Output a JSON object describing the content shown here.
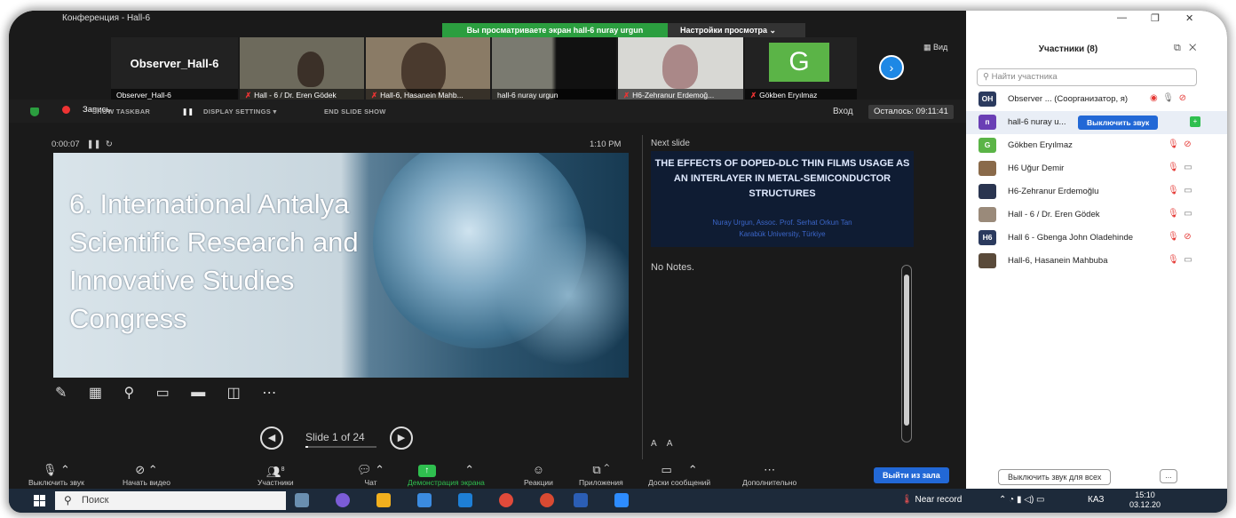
{
  "window": {
    "title": "Конференция - Hall-6"
  },
  "share_banner": {
    "text": "Вы просматриваете экран hall-6 nuray urgun",
    "view_options": "Настройки просмотра",
    "chevron": "⌄"
  },
  "video_strip": {
    "tiles": [
      {
        "name": "Observer_Hall-6",
        "display": "Observer_Hall-6",
        "muted": false
      },
      {
        "name": "Hall - 6 / Dr. Eren Gödek",
        "muted": true
      },
      {
        "name": "Hall-6, Hasanein Mahb...",
        "muted": true
      },
      {
        "name": "hall-6 nuray urgun",
        "muted": false
      },
      {
        "name": "H6-Zehranur Erdemoğ...",
        "muted": true
      },
      {
        "name": "Gökben Eryılmaz",
        "muted": true,
        "initial": "G"
      }
    ],
    "view_label": "Вид"
  },
  "control_row": {
    "record_label": "Запись",
    "presenter_labels": [
      "SHOW TASKBAR",
      "DISPLAY SETTINGS ▾",
      "END SLIDE SHOW"
    ],
    "login": "Вход",
    "remaining": "Осталось: 09:11:41"
  },
  "presenter": {
    "elapsed": "0:00:07",
    "clock": "1:10 PM",
    "next_slide_label": "Next slide",
    "current_slide_title": "6. International Antalya\nScientific Research and\nInnovative Studies\nCongress",
    "next_slide": {
      "title": "THE EFFECTS OF DOPED-DLC THIN FILMS USAGE AS AN INTERLAYER IN METAL-SEMICONDUCTOR STRUCTURES",
      "authors": "Nuray Urgun,  Assoc. Prof. Serhat Orkun Tan",
      "affiliation": "Karabük University, Türkiye"
    },
    "notes": "No Notes.",
    "slide_counter": "Slide 1 of 24",
    "slide_progress": 0.04
  },
  "toolbar": {
    "items": [
      {
        "label": "Выключить звук"
      },
      {
        "label": "Начать видео"
      },
      {
        "label": "Участники",
        "count": "8"
      },
      {
        "label": "Чат"
      },
      {
        "label": "Демонстрация экрана"
      },
      {
        "label": "Реакции"
      },
      {
        "label": "Приложения"
      },
      {
        "label": "Доски сообщений"
      },
      {
        "label": "Дополнительно"
      }
    ],
    "leave": "Выйти из зала"
  },
  "participants": {
    "title": "Участники (8)",
    "search_placeholder": "Найти участника",
    "list": [
      {
        "initials": "ОН",
        "name": "Observer ... (Соорганизатор, я)",
        "color": "#2b3a5e"
      },
      {
        "initials": "п",
        "name": "hall-6 nuray u...",
        "color": "#6a3fb5",
        "mute_button": "Выключить звук"
      },
      {
        "initials": "G",
        "name": "Gökben Eryılmaz",
        "color": "#5bb447"
      },
      {
        "initials": "",
        "name": "H6 Uğur Demir",
        "color": "#8a6a4a"
      },
      {
        "initials": "",
        "name": "H6-Zehranur Erdemoğlu",
        "color": "#2a3550"
      },
      {
        "initials": "",
        "name": "Hall - 6 / Dr. Eren Gödek",
        "color": "#9a8a7a"
      },
      {
        "initials": "H6",
        "name": "Hall 6 - Gbenga John Oladehinde",
        "color": "#2b3a5e"
      },
      {
        "initials": "",
        "name": "Hall-6, Hasanein Mahbuba",
        "color": "#5a4a3a"
      }
    ],
    "mute_all": "Выключить звук для всех",
    "more": "..."
  },
  "taskbar": {
    "search": "Поиск",
    "record": "Near record",
    "lang": "КАЗ",
    "time": "15:10",
    "date": "03.12.20"
  }
}
